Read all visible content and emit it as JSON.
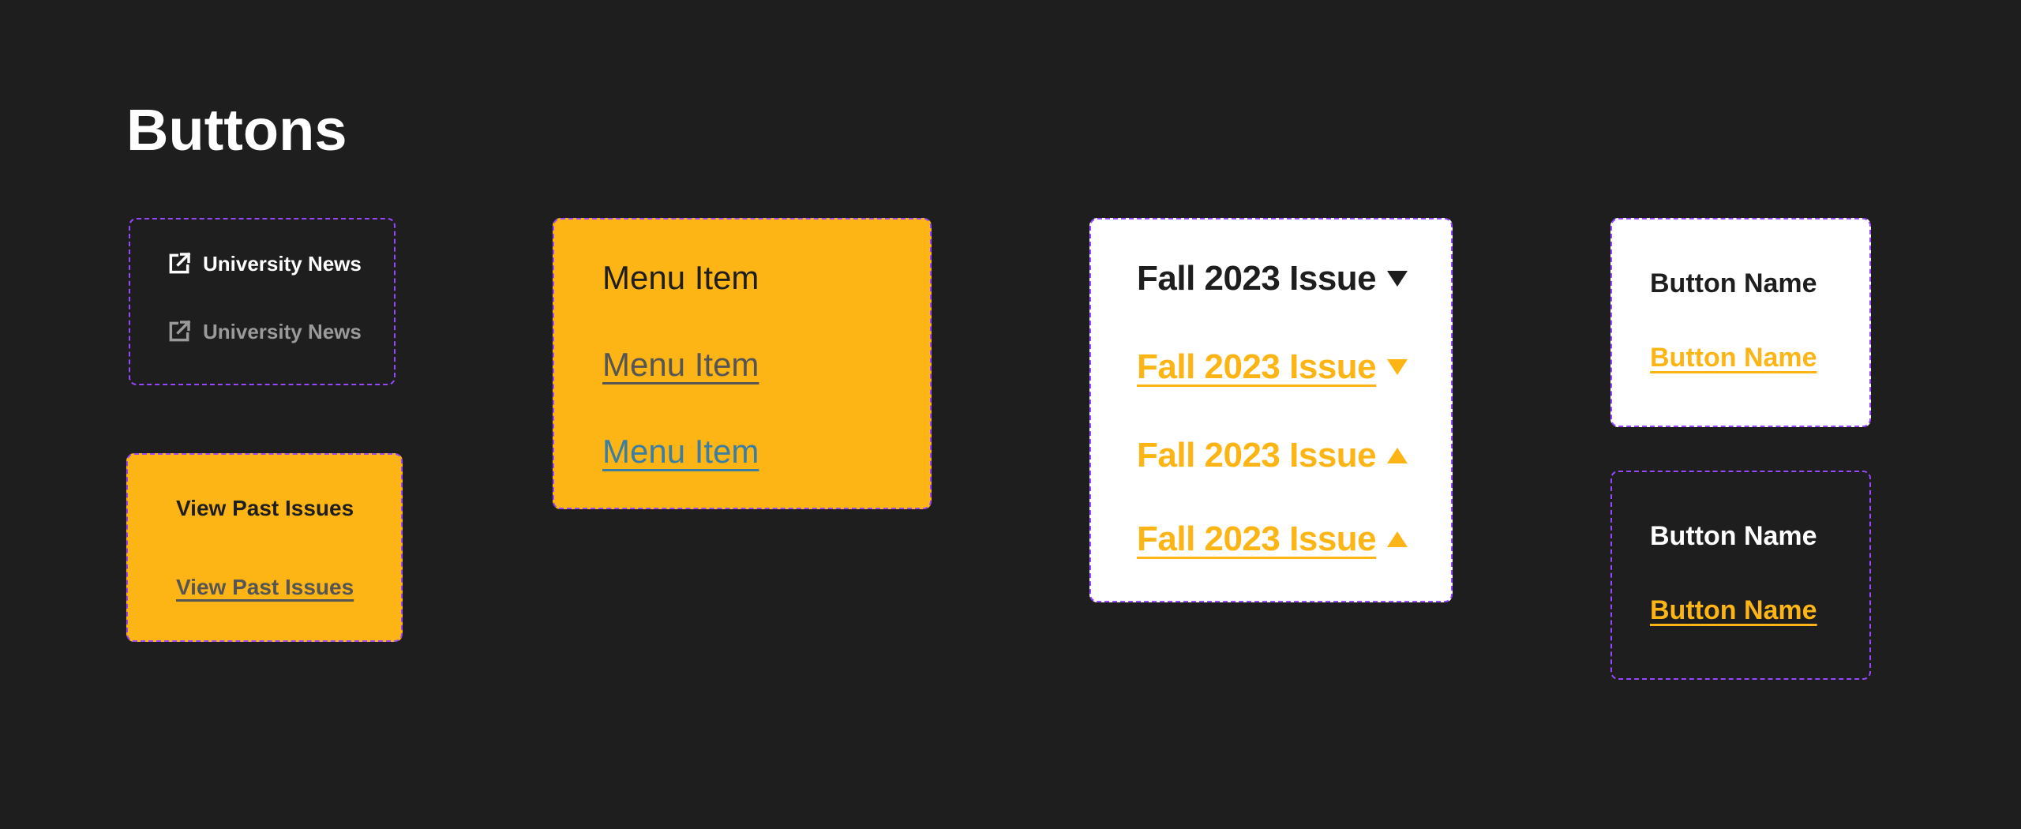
{
  "page": {
    "title": "Buttons"
  },
  "colors": {
    "background": "#1e1e1e",
    "gold": "#fdb515",
    "white": "#ffffff",
    "dark_text": "#1e1e1e",
    "muted_text": "#555555",
    "link_blue": "#3b7ea1",
    "muted_gray": "#9a9a9a",
    "frame_border": "#9747ff"
  },
  "external_links": {
    "icon": "external-link-icon",
    "items": [
      {
        "label": "University News",
        "state": "default"
      },
      {
        "label": "University News",
        "state": "hover"
      }
    ]
  },
  "view_past_issues": {
    "items": [
      {
        "label": "View Past Issues",
        "state": "default"
      },
      {
        "label": "View Past Issues",
        "state": "hover"
      }
    ]
  },
  "menu_items": {
    "items": [
      {
        "label": "Menu Item",
        "state": "default"
      },
      {
        "label": "Menu Item",
        "state": "hover"
      },
      {
        "label": "Menu Item",
        "state": "active"
      }
    ]
  },
  "issue_dropdowns": {
    "items": [
      {
        "label": "Fall 2023 Issue",
        "icon": "caret-down-icon",
        "state": "default"
      },
      {
        "label": "Fall 2023 Issue",
        "icon": "caret-down-icon",
        "state": "hover"
      },
      {
        "label": "Fall 2023 Issue",
        "icon": "caret-up-icon",
        "state": "expanded"
      },
      {
        "label": "Fall 2023 Issue",
        "icon": "caret-up-icon",
        "state": "expanded-hover"
      }
    ]
  },
  "button_names_light": {
    "items": [
      {
        "label": "Button Name",
        "state": "default"
      },
      {
        "label": "Button Name",
        "state": "hover"
      }
    ]
  },
  "button_names_dark": {
    "items": [
      {
        "label": "Button Name",
        "state": "default"
      },
      {
        "label": "Button Name",
        "state": "hover"
      }
    ]
  }
}
